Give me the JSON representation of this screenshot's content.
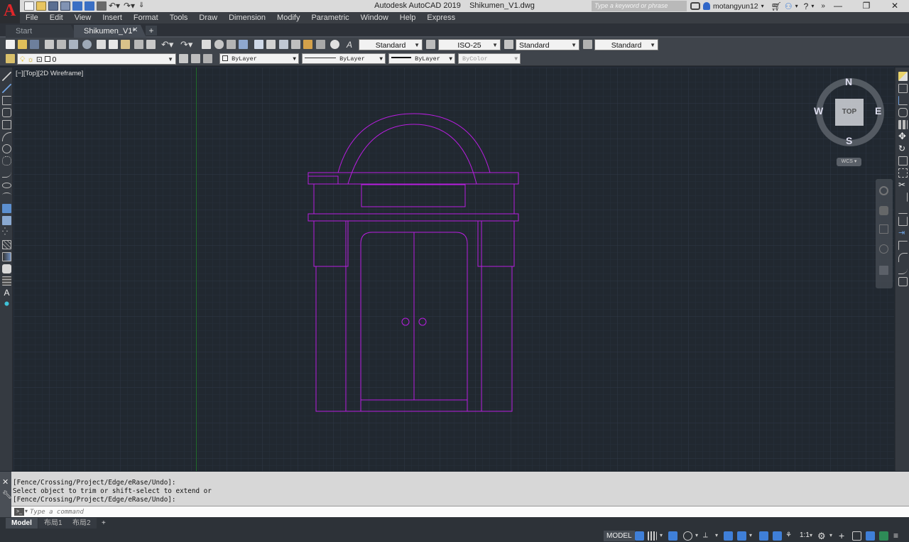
{
  "app": {
    "logo_letter": "A",
    "title": "Autodesk AutoCAD 2019    Shikumen_V1.dwg",
    "search_placeholder": "Type a keyword or phrase",
    "username": "motangyun12",
    "window_controls": {
      "minimize": "—",
      "maximize": "❐",
      "close": "✕"
    }
  },
  "menu": [
    "File",
    "Edit",
    "View",
    "Insert",
    "Format",
    "Tools",
    "Draw",
    "Dimension",
    "Modify",
    "Parametric",
    "Window",
    "Help",
    "Express"
  ],
  "doc_tabs": {
    "start": "Start",
    "current": "Shikumen_V1*",
    "close": "✕",
    "new": "+"
  },
  "styles_toolbar": {
    "text_style": "Standard",
    "dim_style": "ISO-25",
    "table_style": "Standard",
    "mleader_style": "Standard"
  },
  "layers_toolbar": {
    "current_layer": "0",
    "color": "ByLayer",
    "linetype": "ByLayer",
    "lineweight": "ByLayer",
    "plot_style": "ByColor"
  },
  "viewport": {
    "label": "[−][Top][2D Wireframe]",
    "viewcube": {
      "n": "N",
      "s": "S",
      "e": "E",
      "w": "W",
      "face": "TOP",
      "ucs": "WCS"
    }
  },
  "drawing": {
    "line_color": "#b81ee0",
    "grid_color": "#2a3340",
    "axis_color": "#1f6b2a"
  },
  "command": {
    "history": [
      "[Fence/Crossing/Project/Edge/eRase/Undo]:",
      "Select object to trim or shift-select to extend or",
      "[Fence/Crossing/Project/Edge/eRase/Undo]:"
    ],
    "placeholder": "Type a command"
  },
  "layout_tabs": [
    "Model",
    "布局1",
    "布局2",
    "+"
  ],
  "status": {
    "model": "MODEL",
    "scale": "1:1"
  },
  "colors": {
    "accent_blue": "#3f7fd8",
    "bg_dark": "#212830",
    "toolbar": "#3f444b"
  }
}
